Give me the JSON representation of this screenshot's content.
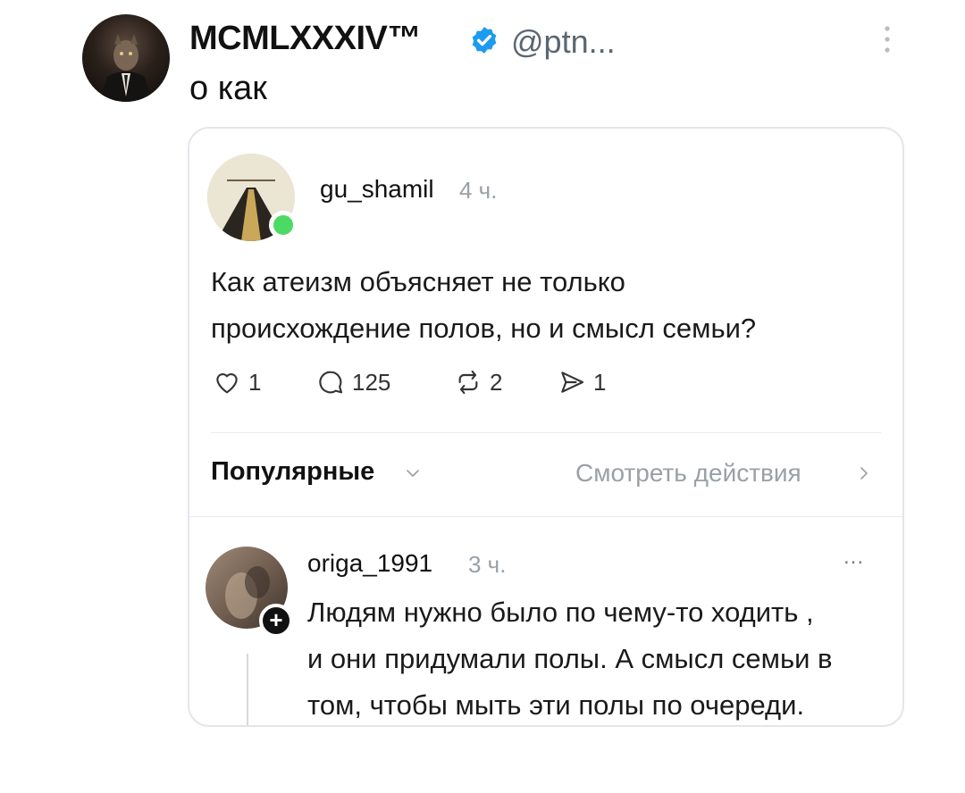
{
  "tweet": {
    "author_name": "MCMLXXXIV™",
    "handle": "@ptn...",
    "text": "о как",
    "icons": {
      "avatar": "avatar",
      "verified": "verified-badge-icon",
      "menu": "vertical-dots-icon"
    },
    "verified_color": "#1d9bf0"
  },
  "quoted_post": {
    "username": "gu_shamil",
    "time": "4 ч.",
    "text_line1": "Как атеизм объясняет не только",
    "text_line2": "происхождение полов, но и смысл семьи?",
    "online_color": "#4cd964",
    "actions": [
      {
        "icon": "heart-icon",
        "count": "1"
      },
      {
        "icon": "comment-icon",
        "count": "125"
      },
      {
        "icon": "repost-icon",
        "count": "2"
      },
      {
        "icon": "send-icon",
        "count": "1"
      }
    ],
    "sort_label": "Популярные",
    "activity_link": "Смотреть действия"
  },
  "reply": {
    "username": "origa_1991",
    "time": "3 ч.",
    "more": "...",
    "line1": "Людям нужно было по чему-то ходить ,",
    "line2": "и они придумали полы. А смысл семьи в",
    "line3": "том, чтобы мыть эти полы по очереди.",
    "follow_symbol": "+"
  }
}
